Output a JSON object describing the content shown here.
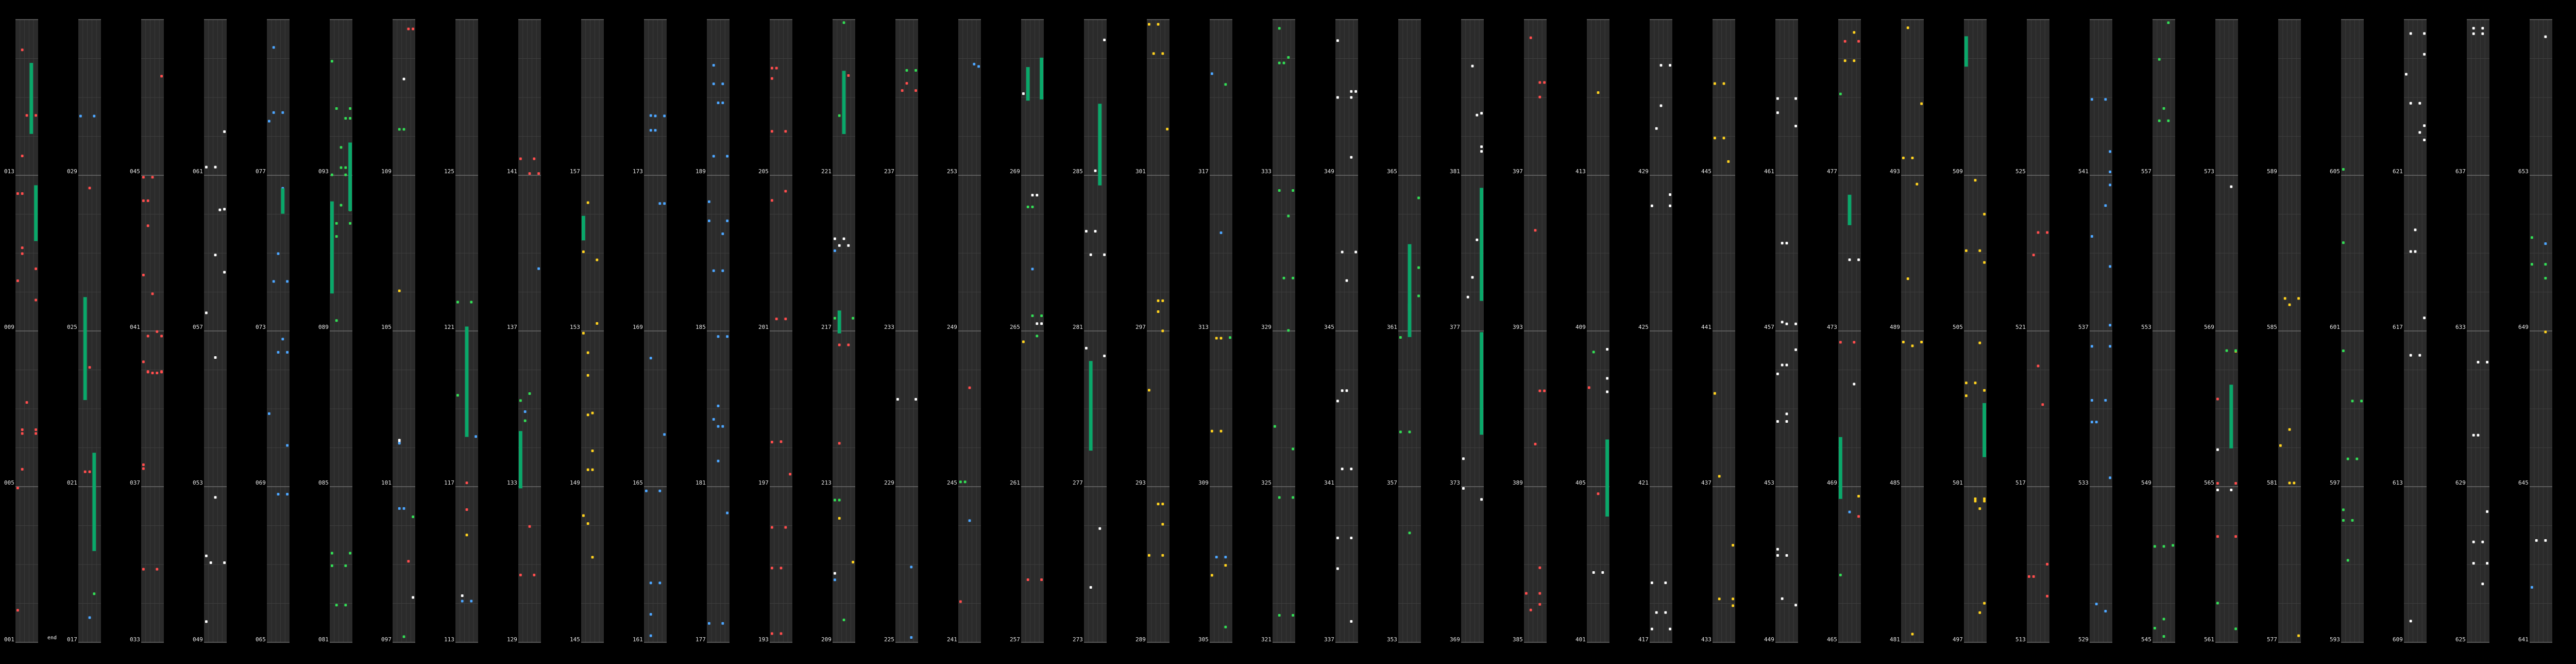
{
  "chart": {
    "type": "rhythm-chart-overview",
    "columns": 51,
    "bars_per_column": 4,
    "first_bar": 1,
    "last_bar": 680,
    "note_colors": {
      "1": "#ff4d4d",
      "2": "#4da6ff",
      "3": "#33dd55",
      "4": "#ffd21f",
      "5": "#ffffff"
    },
    "hold_color": "#0aa86a",
    "background": "#000000",
    "lane_bg": "#2b2b2b",
    "gridline": "#555555"
  },
  "chart_data": {
    "type": "table",
    "bar_labels": [
      "001",
      "013",
      "025",
      "037",
      "049",
      "061",
      "073",
      "085",
      "097",
      "109",
      "121",
      "133",
      "145",
      "157",
      "169",
      "181",
      "193",
      "205",
      "217",
      "229",
      "241",
      "253",
      "265",
      "277",
      "289",
      "301",
      "313",
      "325",
      "337",
      "349",
      "361",
      "373",
      "385",
      "397",
      "409",
      "421",
      "433",
      "445",
      "457",
      "469",
      "481",
      "493",
      "505",
      "517",
      "529",
      "541",
      "553",
      "565",
      "577",
      "589",
      "601",
      "613",
      "625",
      "637",
      "649",
      "661",
      "673"
    ],
    "marker_text": "end"
  }
}
